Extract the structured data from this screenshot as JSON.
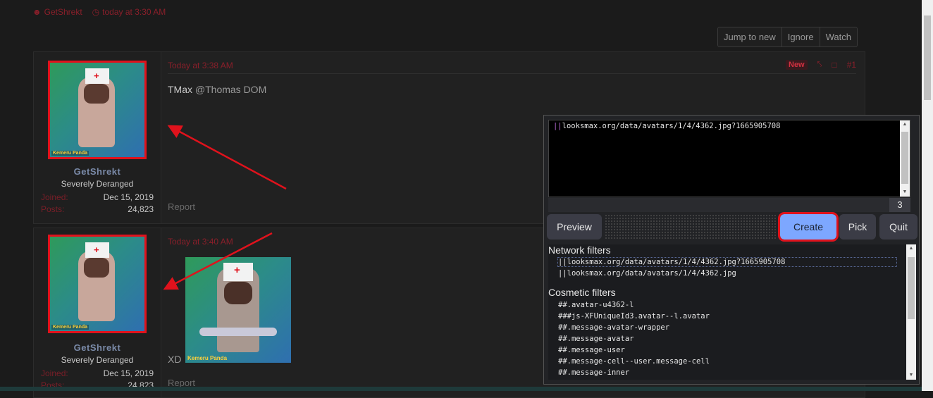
{
  "thread_meta": {
    "author": "GetShrekt",
    "time": "today at 3:30 AM"
  },
  "thread_actions": [
    "Jump to new",
    "Ignore",
    "Watch"
  ],
  "posts": [
    {
      "user": {
        "name": "GetShrekt",
        "title": "Severely Deranged",
        "joined_label": "Joined:",
        "joined": "Dec 15, 2019",
        "posts_label": "Posts:",
        "posts": "24,823",
        "avatar_tag": "Kemeru Panda"
      },
      "time": "Today at 3:38 AM",
      "badge": "New",
      "number": "#1",
      "text_strong": "TMax",
      "text": "@Thomas DOM",
      "report": "Report"
    },
    {
      "user": {
        "name": "GetShrekt",
        "title": "Severely Deranged",
        "joined_label": "Joined:",
        "joined": "Dec 15, 2019",
        "posts_label": "Posts:",
        "posts": "24,823",
        "avatar_tag": "Kemeru Panda"
      },
      "time": "Today at 3:40 AM",
      "text": "XD",
      "attachment_tag": "Kemeru Panda",
      "report": "Report"
    }
  ],
  "picker": {
    "filter_text": "looksmax.org/data/avatars/1/4/4362.jpg?1665905708",
    "filter_prefix": "||",
    "count": "3",
    "buttons": {
      "preview": "Preview",
      "create": "Create",
      "pick": "Pick",
      "quit": "Quit"
    },
    "network_title": "Network filters",
    "network_filters": [
      "||looksmax.org/data/avatars/1/4/4362.jpg?1665905708",
      "||looksmax.org/data/avatars/1/4/4362.jpg"
    ],
    "cosmetic_title": "Cosmetic filters",
    "cosmetic_filters": [
      "##.avatar-u4362-l",
      "###js-XFUniqueId3.avatar--l.avatar",
      "##.message-avatar-wrapper",
      "##.message-avatar",
      "##.message-user",
      "##.message-cell--user.message-cell",
      "##.message-inner"
    ]
  },
  "colors": {
    "accent_red": "#e0121c",
    "create_blue": "#7da7ff",
    "muted_red": "#8a1f2a"
  }
}
